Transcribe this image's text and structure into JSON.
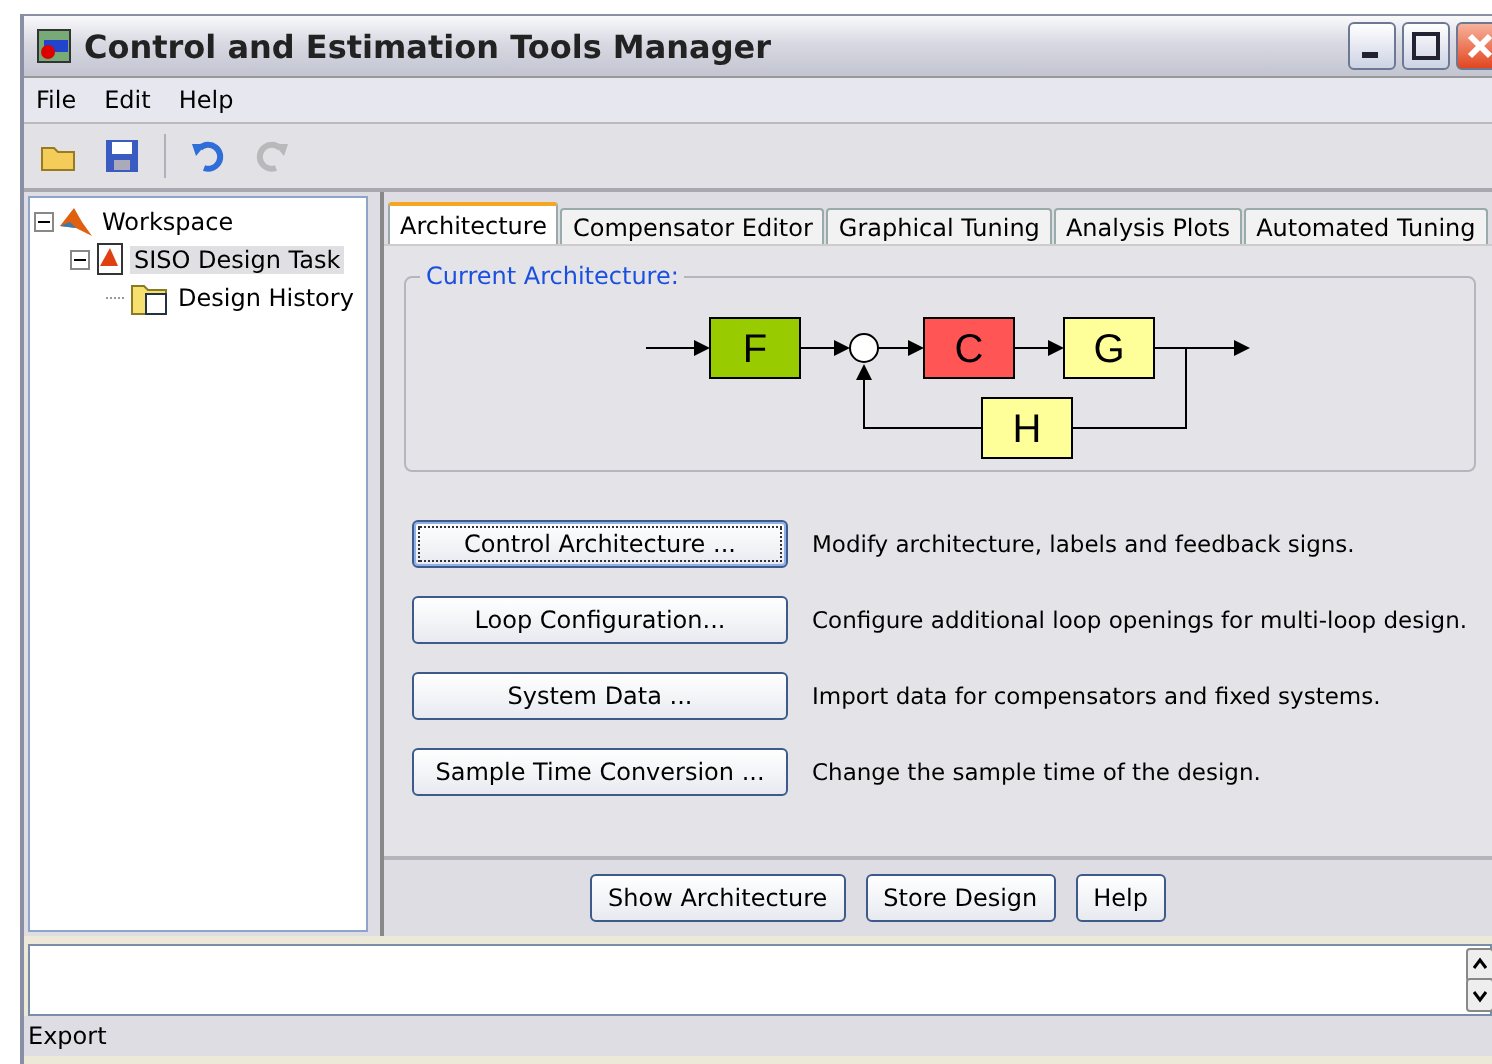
{
  "window": {
    "title": "Control and Estimation Tools Manager"
  },
  "menu": [
    {
      "label": "File"
    },
    {
      "label": "Edit"
    },
    {
      "label": "Help"
    }
  ],
  "toolbar": [
    {
      "kind": "open",
      "disabled": false
    },
    {
      "kind": "save",
      "disabled": false
    },
    {
      "kind": "undo",
      "disabled": false
    },
    {
      "kind": "redo",
      "disabled": true
    }
  ],
  "tree": [
    {
      "label": "Workspace",
      "kind": "workspace",
      "selected": false,
      "expanded": true,
      "children": [
        {
          "label": "SISO Design Task",
          "kind": "task",
          "selected": true,
          "expanded": true,
          "children": [
            {
              "label": "Design History",
              "kind": "history",
              "selected": false
            }
          ]
        }
      ]
    }
  ],
  "tabs": [
    {
      "label": "Architecture",
      "selected": true
    },
    {
      "label": "Compensator Editor",
      "selected": false
    },
    {
      "label": "Graphical Tuning",
      "selected": false
    },
    {
      "label": "Analysis Plots",
      "selected": false
    },
    {
      "label": "Automated Tuning",
      "selected": false
    }
  ],
  "architecture": {
    "title": "Current Architecture:",
    "blocks": [
      {
        "label": "F",
        "color": "#99cc00"
      },
      {
        "label": "C",
        "color": "#ff5555"
      },
      {
        "label": "G",
        "color": "#ffff99"
      },
      {
        "label": "H",
        "color": "#ffff99"
      }
    ]
  },
  "actions": [
    {
      "button": "Control Architecture ...",
      "description": "Modify architecture, labels and feedback signs.",
      "focused": true
    },
    {
      "button": "Loop Configuration...",
      "description": "Configure additional loop openings for multi-loop design.",
      "focused": false
    },
    {
      "button": "System Data ...",
      "description": "Import data for compensators and fixed systems.",
      "focused": false
    },
    {
      "button": "Sample Time Conversion ...",
      "description": "Change the sample time of the design.",
      "focused": false
    }
  ],
  "bottom_buttons": [
    "Show Architecture",
    "Store Design",
    "Help"
  ],
  "status_bar": "Export"
}
